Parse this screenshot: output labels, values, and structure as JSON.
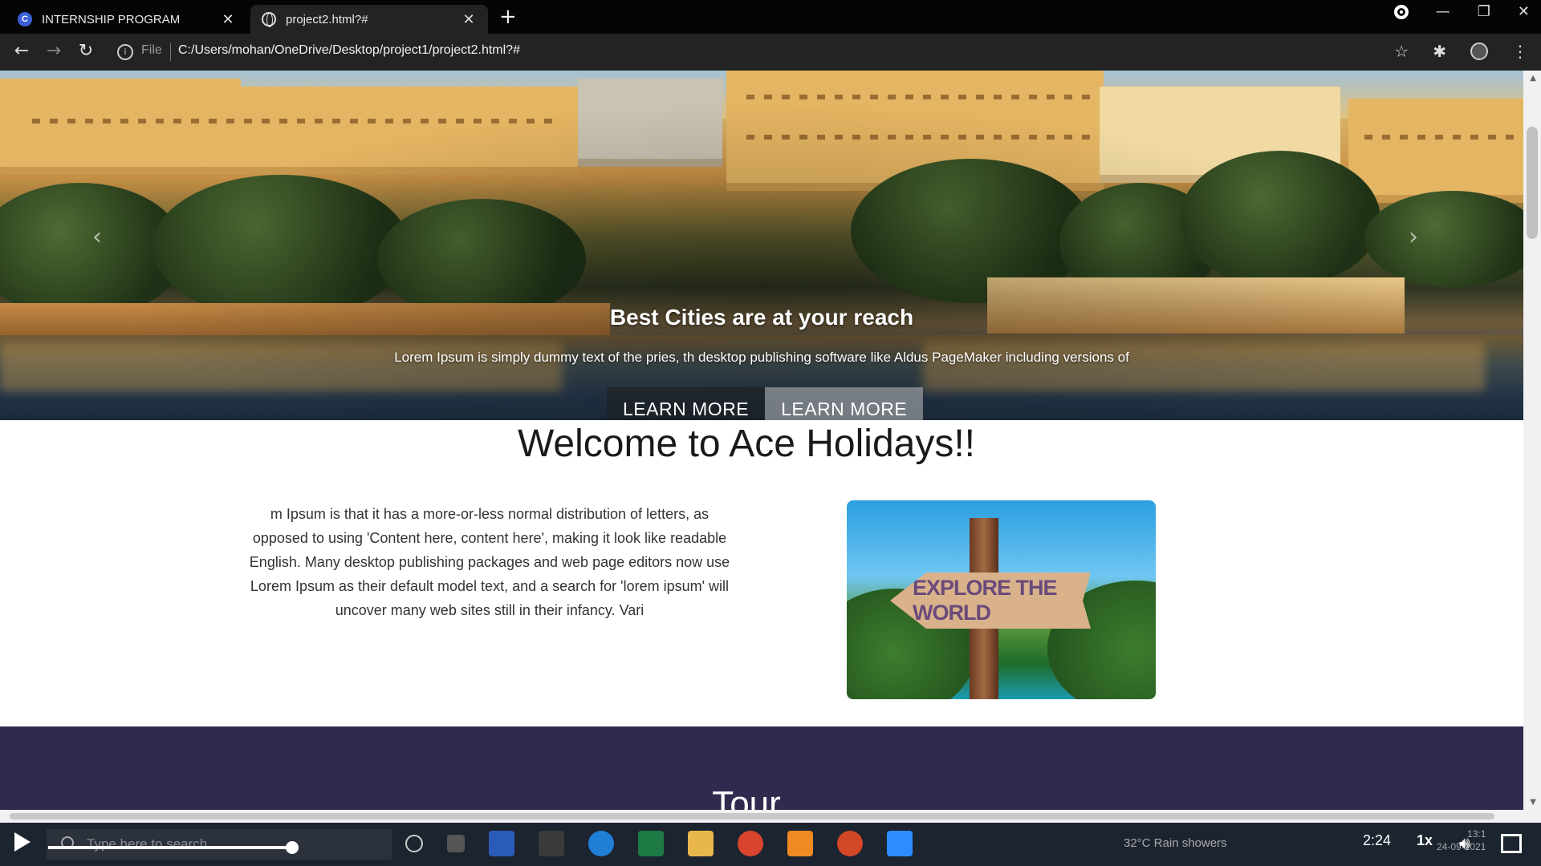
{
  "browser": {
    "tabs": [
      {
        "title": "INTERNSHIP PROGRAM",
        "active": false,
        "favicon": "c-logo-icon"
      },
      {
        "title": "project2.html?#",
        "active": true,
        "favicon": "globe-icon"
      }
    ],
    "address": {
      "scheme_label": "File",
      "url": "C:/Users/mohan/OneDrive/Desktop/project1/project2.html?#"
    }
  },
  "hero": {
    "title": "Best Cities are at your reach",
    "subtitle": "Lorem Ipsum is simply dummy text of the pries, th desktop publishing software like Aldus PageMaker including versions of",
    "buttons": [
      {
        "label": "LEARN MORE"
      },
      {
        "label": "LEARN MORE"
      }
    ],
    "indicator_count": 3,
    "active_indicator": 1
  },
  "welcome": {
    "title": "Welcome to Ace Holidays!!",
    "text": "m Ipsum is that it has a more-or-less normal distribution of letters, as opposed to using 'Content here, content here', making it look like readable English. Many desktop publishing packages and web page editors now use Lorem Ipsum as their default model text, and a search for 'lorem ipsum' will uncover many web sites still in their infancy. Vari",
    "image_text": "EXPLORE THE WORLD"
  },
  "tour": {
    "title": "Tour"
  },
  "taskbar": {
    "search_placeholder": "Type here to search",
    "weather": "32°C  Rain showers",
    "video_time": "2:24",
    "playback_speed": "1x",
    "clock_time": "13:1",
    "clock_date": "24-09-2021",
    "progress_fraction": 0.195
  },
  "colors": {
    "tour_band": "#2f2b4f",
    "chrome_dark": "#050505",
    "chrome_toolbar": "#232323"
  }
}
